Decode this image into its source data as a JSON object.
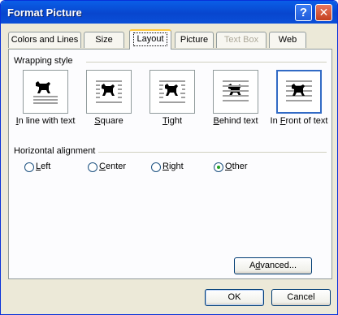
{
  "window": {
    "title": "Format Picture",
    "help_label": "?",
    "close_label": "✕"
  },
  "tabs": [
    {
      "label": "Colors and Lines",
      "state": "normal"
    },
    {
      "label": "Size",
      "state": "normal"
    },
    {
      "label": "Layout",
      "state": "active"
    },
    {
      "label": "Picture",
      "state": "normal"
    },
    {
      "label": "Text Box",
      "state": "disabled"
    },
    {
      "label": "Web",
      "state": "normal"
    }
  ],
  "wrapping": {
    "heading": "Wrapping style",
    "options": [
      {
        "mnemonic": "I",
        "rest": "n line with text",
        "icon": "inline-wrap-icon"
      },
      {
        "mnemonic": "S",
        "rest": "quare",
        "icon": "square-wrap-icon"
      },
      {
        "mnemonic": "T",
        "rest": "ight",
        "icon": "tight-wrap-icon"
      },
      {
        "mnemonic": "B",
        "rest": "ehind text",
        "icon": "behind-text-icon"
      },
      {
        "mnemonic": "F",
        "rest": "ront of text",
        "prefix": "In ",
        "icon": "in-front-of-text-icon",
        "selected": true
      }
    ]
  },
  "alignment": {
    "heading": "Horizontal alignment",
    "options": [
      {
        "mnemonic": "L",
        "rest": "eft",
        "checked": false
      },
      {
        "mnemonic": "C",
        "rest": "enter",
        "checked": false
      },
      {
        "mnemonic": "R",
        "rest": "ight",
        "checked": false
      },
      {
        "mnemonic": "O",
        "rest": "ther",
        "checked": true
      }
    ]
  },
  "buttons": {
    "advanced": {
      "mnemonic": "d",
      "prefix": "A",
      "rest": "vanced..."
    },
    "ok": "OK",
    "cancel": "Cancel"
  },
  "colors": {
    "accent": "#316AC5",
    "titlebar": "#0A5FE8",
    "dialog_bg": "#ECE9D8",
    "tab_highlight": "#FFC83C"
  }
}
